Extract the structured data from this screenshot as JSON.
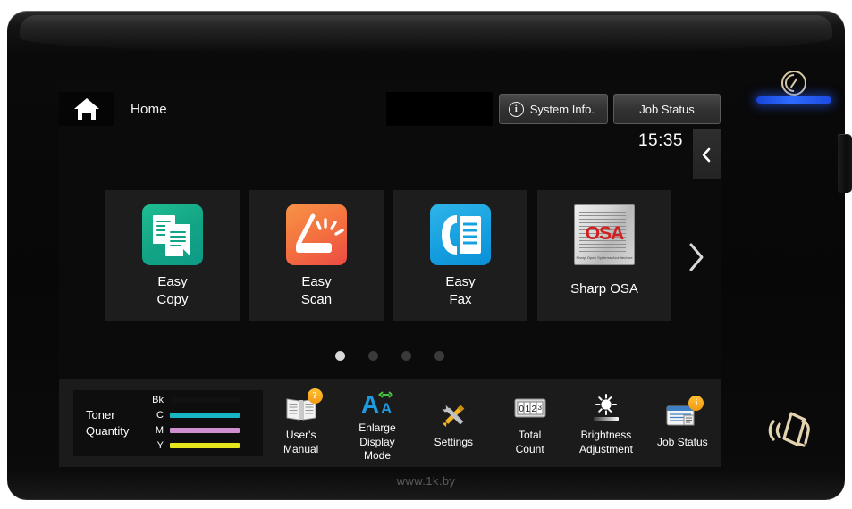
{
  "header": {
    "home_label": "Home",
    "home_icon": "home-icon",
    "system_info_label": "System Info.",
    "system_info_icon": "info-circle-icon",
    "job_status_label": "Job Status"
  },
  "status": {
    "clock": "15:35",
    "panel_toggle_icon": "chevron-left-icon"
  },
  "tiles": [
    {
      "label_line1": "Easy",
      "label_line2": "Copy",
      "icon": "copy-icon",
      "color": "#12a385"
    },
    {
      "label_line1": "Easy",
      "label_line2": "Scan",
      "icon": "scanner-icon",
      "color": "#f4713f"
    },
    {
      "label_line1": "Easy",
      "label_line2": "Fax",
      "icon": "fax-icon",
      "color": "#16a0e0"
    },
    {
      "label_line1": "Sharp OSA",
      "label_line2": "",
      "icon": "sharp-osa-icon",
      "color": "#d21f1f",
      "osa_text": "OSA",
      "osa_subtitle": "Sharp Open Systems Architecture"
    }
  ],
  "next_page_icon": "chevron-right-icon",
  "pager": {
    "total": 4,
    "active_index": 0
  },
  "toner": {
    "title_line1": "Toner",
    "title_line2": "Quantity",
    "rows": [
      {
        "key": "Bk",
        "color": "#111111",
        "level": 100
      },
      {
        "key": "C",
        "color": "#16b5c4",
        "level": 100
      },
      {
        "key": "M",
        "color": "#cf8fd0",
        "level": 100
      },
      {
        "key": "Y",
        "color": "#e5e51d",
        "level": 100
      }
    ]
  },
  "toolbar": [
    {
      "label_line1": "User's",
      "label_line2": "Manual",
      "label_line3": "",
      "icon": "manual-book-icon",
      "badge": "?"
    },
    {
      "label_line1": "Enlarge",
      "label_line2": "Display",
      "label_line3": "Mode",
      "icon": "enlarge-text-icon",
      "badge": ""
    },
    {
      "label_line1": "Settings",
      "label_line2": "",
      "label_line3": "",
      "icon": "tools-icon",
      "badge": ""
    },
    {
      "label_line1": "Total",
      "label_line2": "Count",
      "label_line3": "",
      "icon": "counter-icon",
      "badge": ""
    },
    {
      "label_line1": "Brightness",
      "label_line2": "Adjustment",
      "label_line3": "",
      "icon": "brightness-icon",
      "badge": ""
    },
    {
      "label_line1": "Job Status",
      "label_line2": "",
      "label_line3": "",
      "icon": "job-list-icon",
      "badge": "i"
    }
  ],
  "counter_digits": [
    "0",
    "1",
    "2",
    "3"
  ],
  "enlarge_glyphs": {
    "big_a": "A",
    "small_a": "A"
  },
  "device": {
    "power_icon": "power-button-icon",
    "status_led_color": "#2f6bff",
    "nfc_icon": "nfc-card-reader-icon"
  },
  "watermark": "www.1k.by"
}
